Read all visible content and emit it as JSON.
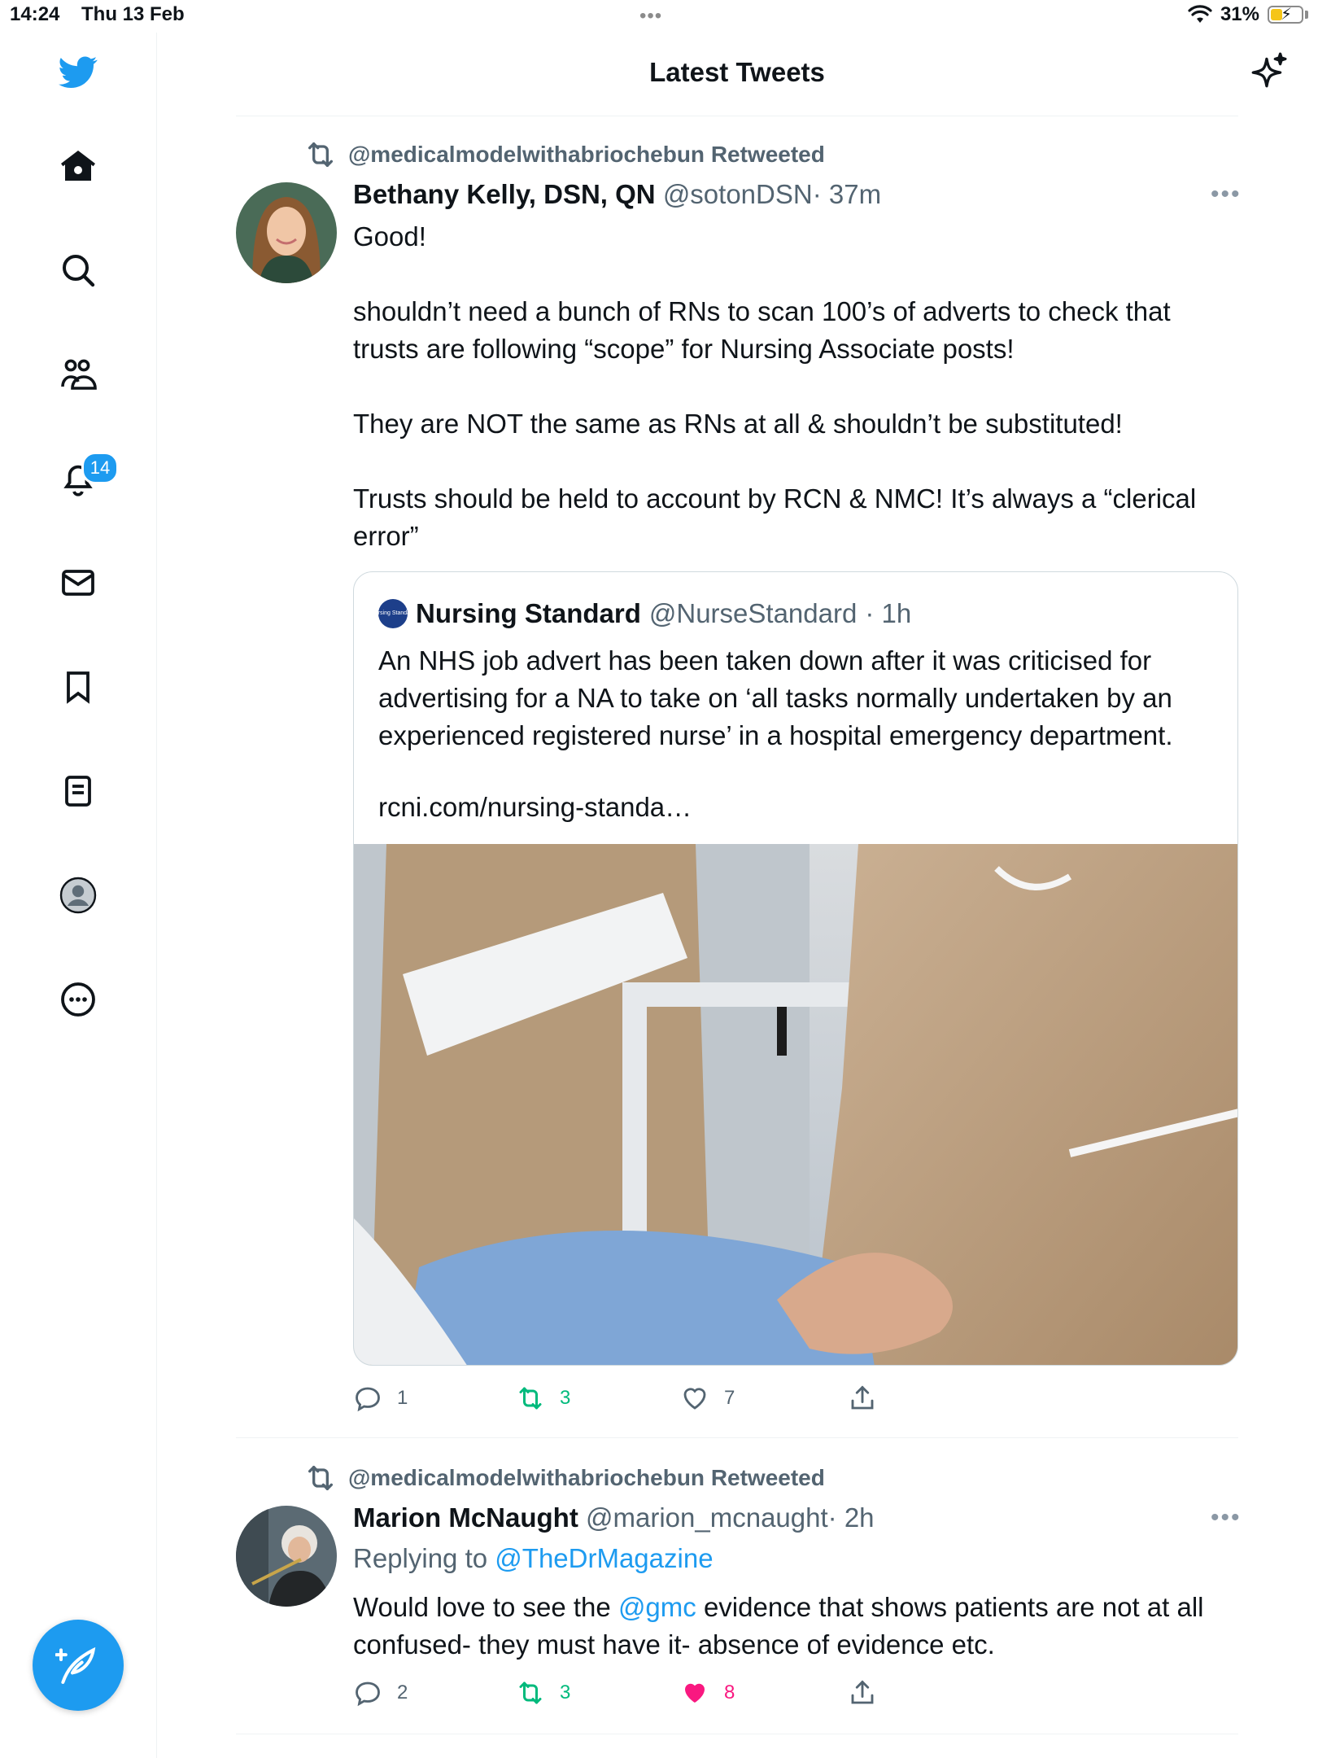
{
  "status_bar": {
    "time": "14:24",
    "date": "Thu 13 Feb",
    "wifi_icon": "wifi-icon",
    "battery": "31%"
  },
  "sidebar": {
    "items": [
      {
        "icon": "twitter-bird-icon"
      },
      {
        "icon": "home-icon"
      },
      {
        "icon": "search-icon"
      },
      {
        "icon": "communities-icon"
      },
      {
        "icon": "notifications-bell-icon",
        "badge": "14"
      },
      {
        "icon": "messages-envelope-icon"
      },
      {
        "icon": "bookmark-icon"
      },
      {
        "icon": "lists-icon"
      },
      {
        "icon": "profile-avatar-icon"
      },
      {
        "icon": "more-circle-icon"
      }
    ],
    "compose_icon": "compose-feather-icon"
  },
  "header": {
    "title": "Latest Tweets",
    "sparkle_icon": "sparkle-icon"
  },
  "tweets": [
    {
      "retweeted_by": "@medicalmodelwithabriochebun Retweeted",
      "name": "Bethany Kelly, DSN, QN",
      "handle": "@sotonDSN",
      "time": "· 37m",
      "paragraphs": [
        "Good!",
        "shouldn’t need a bunch of RNs to scan 100’s of adverts to check that trusts are following “scope” for Nursing Associate posts!",
        "They are NOT the same as RNs at all & shouldn’t be substituted!",
        "Trusts should be held to account by RCN & NMC! It’s always a “clerical error”"
      ],
      "quote": {
        "logo_text": "Nursing Standard",
        "name": "Nursing Standard",
        "handle": "@NurseStandard",
        "time": "· 1h",
        "text": "An NHS job advert has been taken down after it was criticised for advertising for a NA to take on ‘all tasks normally undertaken by an experienced registered nurse’ in a hospital emergency department.",
        "link": "rcni.com/nursing-standa…"
      },
      "replies": "1",
      "retweets": "3",
      "likes": "7"
    },
    {
      "retweeted_by": "@medicalmodelwithabriochebun Retweeted",
      "name": "Marion McNaught",
      "handle": "@marion_mcnaught",
      "time": "· 2h",
      "replying_label": "Replying to",
      "replying_to": "@TheDrMagazine",
      "text_before": "Would love to see the",
      "mention": "@gmc",
      "text_after": "evidence that shows patients are not at all confused- they must have it- absence of evidence etc.",
      "replies": "2",
      "retweets": "3",
      "likes": "8"
    }
  ],
  "colors": {
    "accent": "#1d9bf0",
    "retweet": "#00ba7c",
    "like": "#f91880",
    "secondary_text": "#536471"
  }
}
